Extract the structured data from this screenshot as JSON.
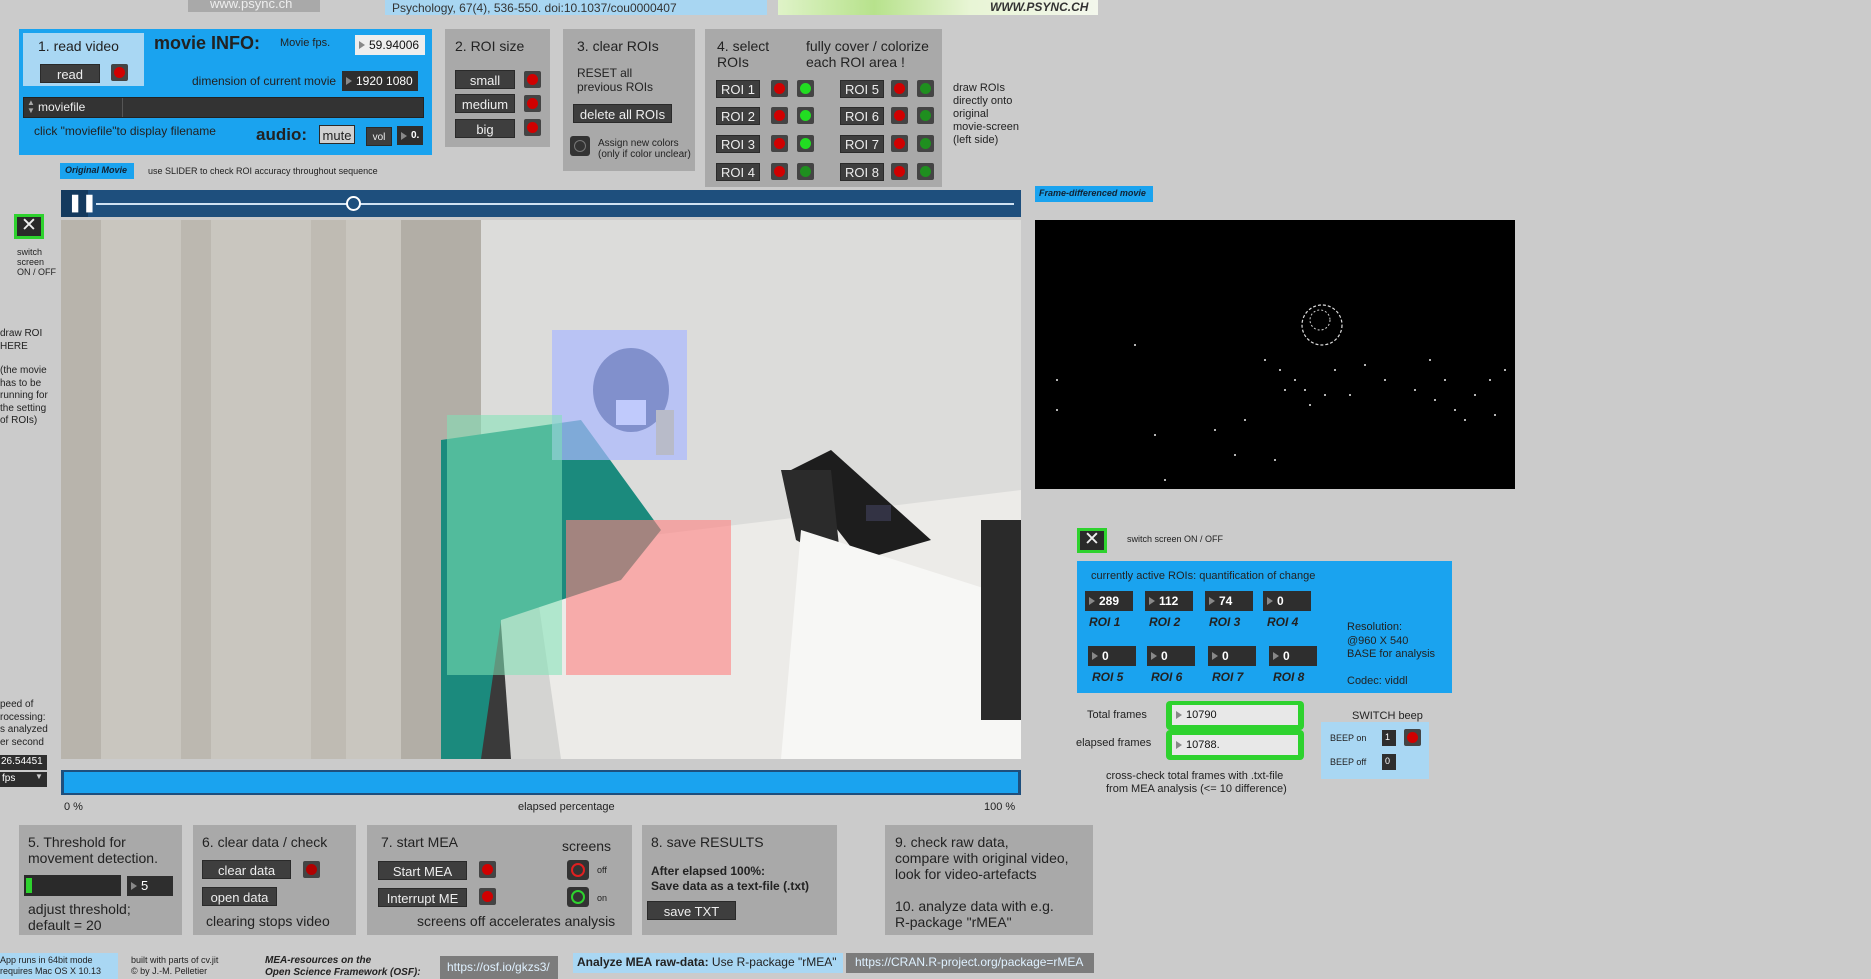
{
  "top": {
    "url_left": "www.psync.ch",
    "citation": "Psychology, 67(4), 536-550. doi:10.1037/cou0000407",
    "logo_text": "WWW.PSYNC.CH"
  },
  "step1": {
    "title": "1. read video",
    "read_button": "read",
    "movie_info": "movie INFO:",
    "fps_label": "Movie fps.",
    "fps_value": "59.94006",
    "dimension_label": "dimension of current movie",
    "dimension_value": "1920 1080",
    "file_select": "moviefile",
    "audio_label": "audio:",
    "mute_button": "mute",
    "vol_label": "vol",
    "vol_value": "0.",
    "hint": "click \"moviefile\"to display  filename"
  },
  "step2": {
    "title": "2. ROI size",
    "sizes": [
      "small",
      "medium",
      "big"
    ]
  },
  "step3": {
    "title": "3. clear ROIs",
    "reset_text_1": "RESET all",
    "reset_text_2": "previous ROIs",
    "delete_button": "delete all ROIs",
    "assign_1": "Assign new colors",
    "assign_2": "(only if color unclear)"
  },
  "step4": {
    "title_1": "4. select",
    "title_2": "ROIs",
    "cover_1": "fully cover / colorize",
    "cover_2": "each ROI area !",
    "rois": [
      "ROI 1",
      "ROI 2",
      "ROI 3",
      "ROI 4",
      "ROI 5",
      "ROI 6",
      "ROI 7",
      "ROI 8"
    ],
    "draw_note": [
      "draw ROIs",
      "directly onto",
      "original",
      "movie-screen",
      "(left side)"
    ]
  },
  "left_panel": {
    "original_tag": "Original Movie",
    "slider_hint": "use SLIDER to check ROI accuracy throughout sequence",
    "switch_note": [
      "switch",
      "screen",
      "ON / OFF"
    ],
    "draw_here": [
      "draw ROI",
      "HERE",
      "",
      "(the movie",
      "has to be",
      "running for",
      "the setting",
      "of ROIs)"
    ],
    "speed_note": [
      "peed of",
      "rocessing:",
      "s analyzed",
      "er second"
    ],
    "speed_value": "26.54451",
    "speed_unit": "fps",
    "pct_start": "0 %",
    "pct_mid": "elapsed percentage",
    "pct_end": "100 %"
  },
  "right_panel": {
    "frame_tag": "Frame-differenced movie",
    "switch_label": "switch screen ON / OFF",
    "quant_title": "currently active ROIs: quantification of change",
    "roi_values": [
      {
        "label": "ROI 1",
        "value": "289"
      },
      {
        "label": "ROI 2",
        "value": "112"
      },
      {
        "label": "ROI 3",
        "value": "74"
      },
      {
        "label": "ROI 4",
        "value": "0"
      },
      {
        "label": "ROI 5",
        "value": "0"
      },
      {
        "label": "ROI 6",
        "value": "0"
      },
      {
        "label": "ROI 7",
        "value": "0"
      },
      {
        "label": "ROI 8",
        "value": "0"
      }
    ],
    "resolution_lines": [
      "Resolution:",
      "@960 X 540",
      "BASE for analysis"
    ],
    "codec": "Codec: viddl",
    "total_frames_label": "Total frames",
    "total_frames": "10790",
    "elapsed_frames_label": "elapsed frames",
    "elapsed_frames": "10788.",
    "cross_check_1": "cross-check total frames with .txt-file",
    "cross_check_2": "from MEA analysis (<= 10 difference)",
    "beep_title": "SWITCH beep",
    "beep_on": "BEEP  on",
    "beep_on_val": "1",
    "beep_off": "BEEP  off",
    "beep_off_val": "0"
  },
  "step5": {
    "title_1": "5. Threshold for",
    "title_2": "movement detection.",
    "value": "5",
    "level": 0.06,
    "note_1": "adjust threshold;",
    "note_2": "default = 20"
  },
  "step6": {
    "title": "6. clear data / check",
    "clear_button": "clear data",
    "open_button": "open data",
    "note": "clearing stops video"
  },
  "step7": {
    "title": "7. start MEA",
    "screens": "screens",
    "start_button": "Start MEA",
    "interrupt_button": "Interrupt ME",
    "off": "off",
    "on": "on",
    "note": "screens off accelerates analysis"
  },
  "step8": {
    "title": "8. save RESULTS",
    "line1": "After elapsed 100%:",
    "line2": "Save data as a text-file (.txt)",
    "save_button": "save TXT"
  },
  "step9": {
    "line1": "9. check raw data,",
    "line2": "compare with original video,",
    "line3": "look for video-artefacts",
    "line4": "10. analyze data with e.g.",
    "line5": "R-package \"rMEA\""
  },
  "footer": {
    "app_note_1": "App runs in 64bit  mode",
    "app_note_2": "requires Mac OS X 10.13",
    "built_1": "built with parts of cv.jit",
    "built_2": "© by J.-M. Pelletier",
    "osf_1": "MEA-resources on the",
    "osf_2": "Open Science Framework (OSF):",
    "osf_link": "https://osf.io/gkzs3/",
    "analyze_bold": "Analyze MEA raw-data:",
    "analyze_text": " Use R-package \"rMEA\"",
    "cran_link": "https://CRAN.R-project.org/package=rMEA"
  },
  "colors": {
    "accent_blue": "#1aa3ef",
    "panel_grey": "#a9a9a9",
    "led_red": "#d00000",
    "led_green": "#22dd22"
  }
}
